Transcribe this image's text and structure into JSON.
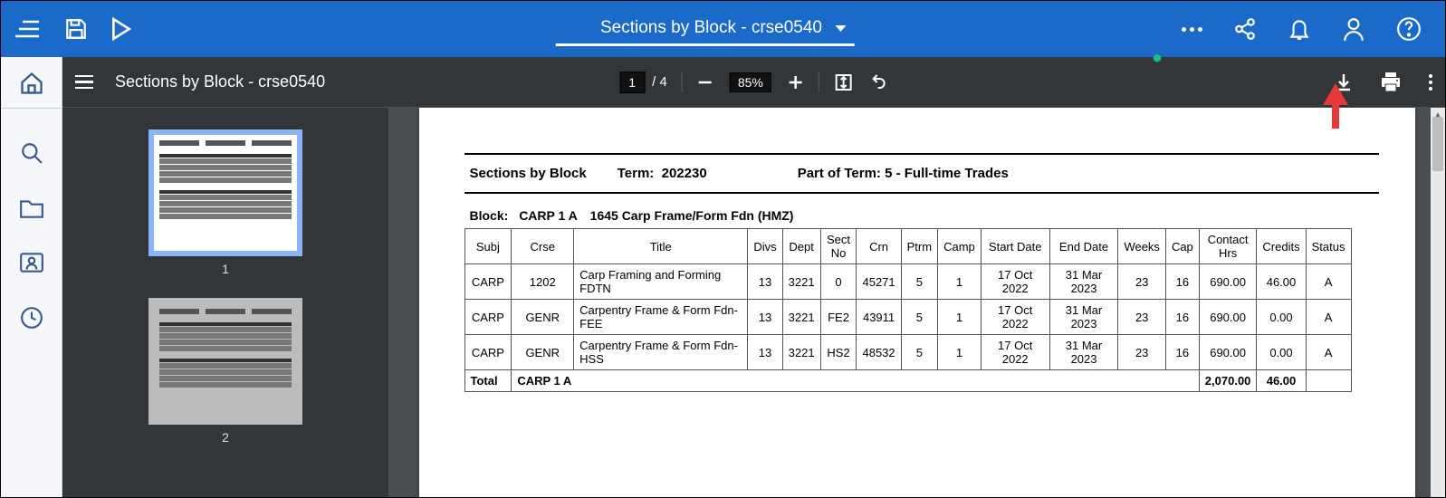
{
  "topbar": {
    "title": "Sections by Block - crse0540"
  },
  "viewer": {
    "title": "Sections by Block - crse0540",
    "page_current": "1",
    "page_sep": "/",
    "page_total": "4",
    "zoom": "85%"
  },
  "thumbnails": [
    {
      "label": "1"
    },
    {
      "label": "2"
    }
  ],
  "report": {
    "section_title": "Sections by Block",
    "term_label": "Term:",
    "term_value": "202230",
    "pot_label": "Part of Term: 5 - Full-time Trades",
    "block_label": "Block:",
    "block_code": "CARP 1 A",
    "block_desc": "1645 Carp Frame/Form Fdn (HMZ)",
    "columns": [
      "Subj",
      "Crse",
      "Title",
      "Divs",
      "Dept",
      "Sect No",
      "Crn",
      "Ptrm",
      "Camp",
      "Start Date",
      "End Date",
      "Weeks",
      "Cap",
      "Contact Hrs",
      "Credits",
      "Status"
    ],
    "rows": [
      [
        "CARP",
        "1202",
        "Carp Framing and Forming FDTN",
        "13",
        "3221",
        "0",
        "45271",
        "5",
        "1",
        "17 Oct 2022",
        "31 Mar 2023",
        "23",
        "16",
        "690.00",
        "46.00",
        "A"
      ],
      [
        "CARP",
        "GENR",
        "Carpentry Frame & Form Fdn-FEE",
        "13",
        "3221",
        "FE2",
        "43911",
        "5",
        "1",
        "17 Oct 2022",
        "31 Mar 2023",
        "23",
        "16",
        "690.00",
        "0.00",
        "A"
      ],
      [
        "CARP",
        "GENR",
        "Carpentry Frame & Form Fdn-HSS",
        "13",
        "3221",
        "HS2",
        "48532",
        "5",
        "1",
        "17 Oct 2022",
        "31 Mar 2023",
        "23",
        "16",
        "690.00",
        "0.00",
        "A"
      ]
    ],
    "total_label": "Total",
    "total_code": "CARP 1 A",
    "total_contact": "2,070.00",
    "total_credits": "46.00"
  }
}
